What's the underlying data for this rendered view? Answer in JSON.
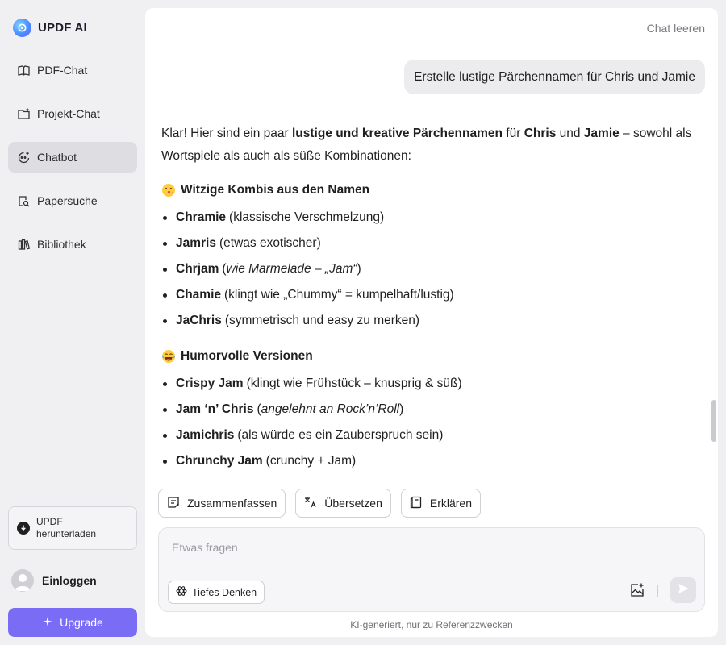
{
  "brand": {
    "name": "UPDF AI"
  },
  "sidebar": {
    "items": [
      {
        "label": "PDF-Chat",
        "icon": "book-open-icon",
        "active": false
      },
      {
        "label": "Projekt-Chat",
        "icon": "folder-plus-icon",
        "active": false
      },
      {
        "label": "Chatbot",
        "icon": "chatbot-icon",
        "active": true
      },
      {
        "label": "Papersuche",
        "icon": "paper-search-icon",
        "active": false
      },
      {
        "label": "Bibliothek",
        "icon": "library-icon",
        "active": false
      }
    ],
    "download": {
      "line1": "UPDF",
      "line2": "herunterladen"
    },
    "login_label": "Einloggen",
    "upgrade_label": "Upgrade"
  },
  "header": {
    "clear_chat": "Chat leeren"
  },
  "conversation": {
    "user_message": "Erstelle lustige Pärchennamen für Chris und Jamie",
    "answer": {
      "intro": {
        "p1": "Klar! Hier sind ein paar ",
        "b1": "lustige und kreative Pärchennamen",
        "p2": " für ",
        "b2": "Chris",
        "p3": " und ",
        "b3": "Jamie",
        "p4": " – sowohl als Wortspiele als auch als süße Kombinationen:"
      },
      "section1": {
        "title": "Witzige Kombis aus den Namen",
        "items": [
          {
            "name": "Chramie",
            "desc": "(klassische Verschmelzung)"
          },
          {
            "name": "Jamris",
            "desc": "(etwas exotischer)"
          },
          {
            "name": "Chrjam",
            "pre": "(",
            "italic": "wie Marmelade – „Jam“",
            "post": ")"
          },
          {
            "name": "Chamie",
            "desc": "(klingt wie „Chummy“ = kumpelhaft/lustig)"
          },
          {
            "name": "JaChris",
            "desc": "(symmetrisch und easy zu merken)"
          }
        ]
      },
      "section2": {
        "title": "Humorvolle Versionen",
        "items": [
          {
            "name": "Crispy Jam",
            "desc": "(klingt wie Frühstück – knusprig & süß)"
          },
          {
            "name": "Jam ‘n’ Chris",
            "pre": "(",
            "italic": "angelehnt an Rock’n’Roll",
            "post": ")"
          },
          {
            "name": "Jamichris",
            "desc": "(als würde es ein Zauberspruch sein)"
          },
          {
            "name": "Chrunchy Jam",
            "desc": "(crunchy + Jam)"
          }
        ]
      }
    }
  },
  "actions": {
    "summarize": "Zusammenfassen",
    "translate": "Übersetzen",
    "explain": "Erklären"
  },
  "composer": {
    "placeholder": "Etwas fragen",
    "deep_think": "Tiefes Denken"
  },
  "footer": {
    "disclaimer": "KI-generiert, nur zu Referenzzwecken"
  },
  "colors": {
    "accent": "#7b6cf6",
    "active_nav": "#dedee2",
    "background": "#f0f0f3"
  }
}
